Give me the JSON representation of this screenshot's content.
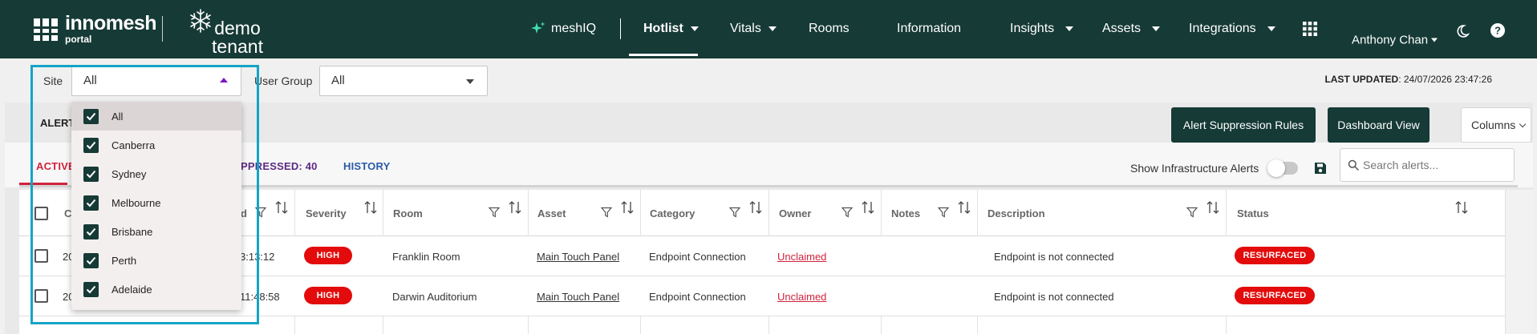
{
  "nav": {
    "logo_name": "innomesh",
    "logo_sub": "portal",
    "tenant": "demo tenant",
    "meshiq": "meshIQ",
    "hotlist": "Hotlist",
    "vitals": "Vitals",
    "rooms": "Rooms",
    "information": "Information",
    "insights": "Insights",
    "assets": "Assets",
    "integrations": "Integrations",
    "user": "Anthony Chan",
    "icons": [
      "sparkle-icon",
      "apps-grid-icon",
      "moon-icon",
      "help-icon"
    ]
  },
  "filters": {
    "site_label": "Site",
    "site_value": "All",
    "user_group_label": "User Group",
    "user_group_value": "All",
    "last_updated_label": "LAST UPDATED",
    "last_updated_value": ": 24/07/2026 23:47:26"
  },
  "site_dropdown": {
    "options": [
      {
        "label": "All",
        "checked": true
      },
      {
        "label": "Canberra",
        "checked": true
      },
      {
        "label": "Sydney",
        "checked": true
      },
      {
        "label": "Melbourne",
        "checked": true
      },
      {
        "label": "Brisbane",
        "checked": true
      },
      {
        "label": "Perth",
        "checked": true
      },
      {
        "label": "Adelaide",
        "checked": true
      }
    ]
  },
  "alerts": {
    "title": "ALERTS",
    "buttons": {
      "suppression": "Alert Suppression Rules",
      "dashboard": "Dashboard View",
      "columns": "Columns"
    },
    "tabs": {
      "active": "ACTIVE",
      "suppressed": "PPRESSED: 40",
      "history": "HISTORY"
    },
    "infra_label": "Show Infrastructure Alerts",
    "infra_on": false,
    "search_placeholder": "Search alerts...",
    "columns": {
      "created": "C",
      "updated": "d",
      "severity": "Severity",
      "room": "Room",
      "asset": "Asset",
      "category": "Category",
      "owner": "Owner",
      "notes": "Notes",
      "description": "Description",
      "status": "Status"
    },
    "rows": [
      {
        "created": "20",
        "updated": "3:13:12",
        "severity": "HIGH",
        "room": "Franklin Room",
        "asset": "Main Touch Panel",
        "category": "Endpoint Connection",
        "owner": "Unclaimed",
        "notes": "",
        "description": "Endpoint is not connected",
        "status": "RESURFACED"
      },
      {
        "created": "20",
        "updated": "11:48:58",
        "severity": "HIGH",
        "room": "Darwin Auditorium",
        "asset": "Main Touch Panel",
        "category": "Endpoint Connection",
        "owner": "Unclaimed",
        "notes": "",
        "description": "Endpoint is not connected",
        "status": "RESURFACED"
      }
    ]
  },
  "colors": {
    "nav_bg": "#163a36",
    "accent_red": "#d0233d",
    "badge_red": "#e30b0b",
    "highlight": "#14a4c7"
  }
}
